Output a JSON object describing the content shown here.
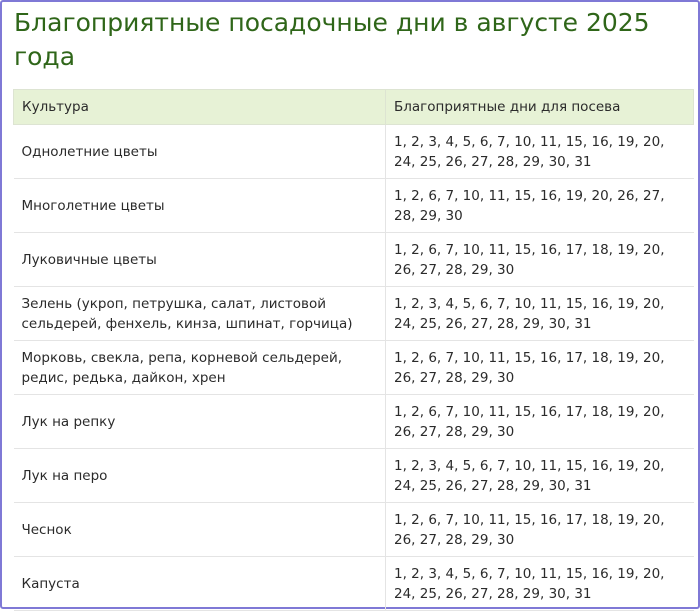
{
  "page": {
    "title": "Благоприятные посадочные дни в августе 2025 года"
  },
  "table": {
    "headers": {
      "culture": "Культура",
      "days": "Благоприятные дни для посева"
    },
    "rows": [
      {
        "culture": "Однолетние цветы",
        "days": "1, 2, 3, 4, 5, 6, 7, 10, 11, 15, 16, 19, 20, 24, 25, 26, 27, 28, 29, 30, 31"
      },
      {
        "culture": "Многолетние цветы",
        "days": "1, 2, 6, 7, 10, 11, 15, 16, 19, 20, 26, 27, 28, 29, 30"
      },
      {
        "culture": "Луковичные цветы",
        "days": "1, 2, 6, 7, 10, 11, 15, 16, 17, 18, 19, 20, 26, 27, 28, 29, 30"
      },
      {
        "culture": "Зелень (укроп, петрушка, салат, листовой сельдерей, фенхель, кинза, шпинат, горчица)",
        "days": "1, 2, 3, 4, 5, 6, 7, 10, 11, 15, 16, 19, 20, 24, 25, 26, 27, 28, 29, 30, 31"
      },
      {
        "culture": "Морковь, свекла, репа, корневой сельдерей, редис, редька, дайкон, хрен",
        "days": "1, 2, 6, 7, 10, 11, 15, 16, 17, 18, 19, 20, 26, 27, 28, 29, 30"
      },
      {
        "culture": "Лук на репку",
        "days": "1, 2, 6, 7, 10, 11, 15, 16, 17, 18, 19, 20, 26, 27, 28, 29, 30"
      },
      {
        "culture": "Лук на перо",
        "days": "1, 2, 3, 4, 5, 6, 7, 10, 11, 15, 16, 19, 20, 24, 25, 26, 27, 28, 29, 30, 31"
      },
      {
        "culture": "Чеснок",
        "days": "1, 2, 6, 7, 10, 11, 15, 16, 17, 18, 19, 20, 26, 27, 28, 29, 30"
      },
      {
        "culture": "Капуста",
        "days": "1, 2, 3, 4, 5, 6, 7, 10, 11, 15, 16, 19, 20, 24, 25, 26, 27, 28, 29, 30, 31"
      }
    ]
  }
}
